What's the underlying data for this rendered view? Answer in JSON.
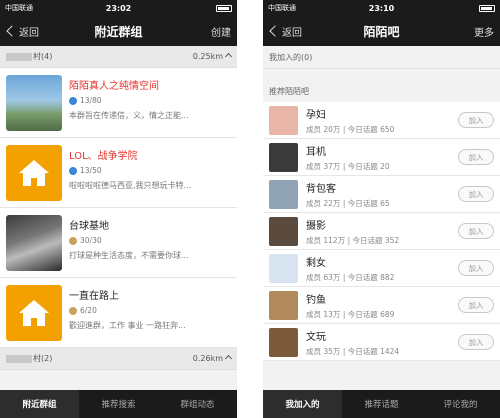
{
  "left": {
    "status": {
      "carrier": "中国联通",
      "time": "23:02"
    },
    "nav": {
      "back": "返回",
      "title": "附近群组",
      "action": "创建"
    },
    "sections": [
      {
        "label": "村(4)",
        "distance": "0.25km",
        "groups": [
          {
            "name": "陌陌真人之纯情空间",
            "count": "13/80",
            "desc": "本群旨在传递信，义，情之正能...",
            "name_red": true,
            "badge": "blue",
            "thumb": "photo1"
          },
          {
            "name": "LOL、战争学院",
            "count": "13/50",
            "desc": "啦啦啦啦德马西亚,我只想玩卡特...",
            "name_red": true,
            "badge": "blue",
            "thumb": "house"
          },
          {
            "name": "台球基地",
            "count": "30/30",
            "desc": "打球是种生活态度，不需要你球...",
            "name_red": false,
            "badge": "gold",
            "thumb": "photo3"
          },
          {
            "name": "一直在路上",
            "count": "6/20",
            "desc": "歡迎進群，工作 事业 一路狂奔...",
            "name_red": false,
            "badge": "gold",
            "thumb": "house"
          }
        ]
      },
      {
        "label": "村(2)",
        "distance": "0.26km"
      }
    ],
    "tabs": [
      "附近群组",
      "推荐搜索",
      "群组动态"
    ],
    "active_tab": 0
  },
  "right": {
    "status": {
      "carrier": "中国联通",
      "time": "23:10"
    },
    "nav": {
      "back": "返回",
      "title": "陌陌吧",
      "action": "更多"
    },
    "joined_label": "我加入的(0)",
    "recommended_label": "推荐陌陌吧",
    "bars": [
      {
        "name": "孕妇",
        "members": "成员 20万",
        "topics": "今日话题 650",
        "join": "加入",
        "color": "#e9b5a8"
      },
      {
        "name": "耳机",
        "members": "成员 37万",
        "topics": "今日话题 20",
        "join": "加入",
        "color": "#3a3a3a"
      },
      {
        "name": "背包客",
        "members": "成员 22万",
        "topics": "今日话题 65",
        "join": "加入",
        "color": "#8fa3b5"
      },
      {
        "name": "摄影",
        "members": "成员 112万",
        "topics": "今日话题 352",
        "join": "加入",
        "color": "#5b4a3e"
      },
      {
        "name": "剩女",
        "members": "成员 63万",
        "topics": "今日话题 882",
        "join": "加入",
        "color": "#d7e4ef"
      },
      {
        "name": "钓鱼",
        "members": "成员 13万",
        "topics": "今日话题 689",
        "join": "加入",
        "color": "#b08a5a"
      },
      {
        "name": "文玩",
        "members": "成员 35万",
        "topics": "今日话题 1424",
        "join": "加入",
        "color": "#7a5a3a"
      }
    ],
    "tabs": [
      "我加入的",
      "推荐话题",
      "评论我的"
    ],
    "active_tab": 0
  }
}
